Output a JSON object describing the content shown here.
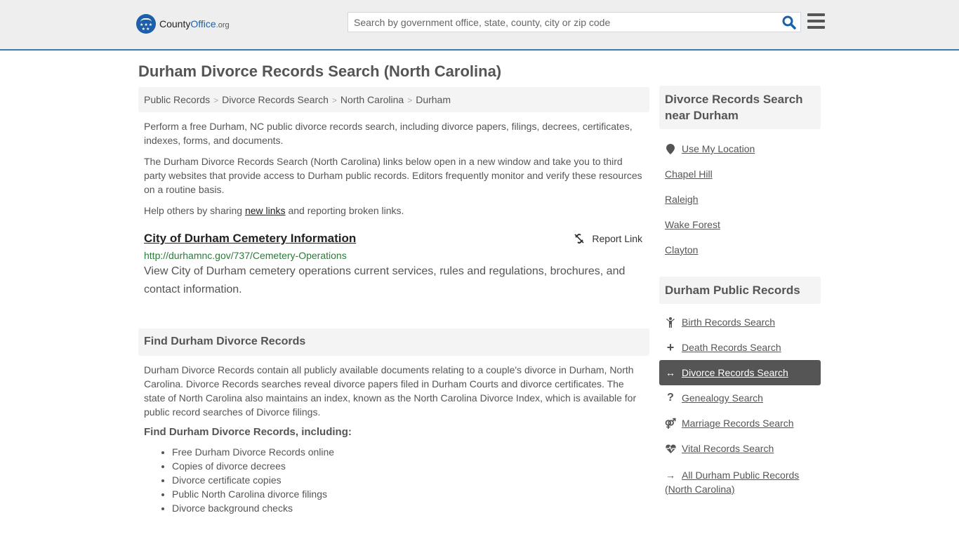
{
  "header": {
    "logo": {
      "county": "County",
      "office": "Office",
      "org": ".org"
    },
    "search_placeholder": "Search by government office, state, county, city or zip code"
  },
  "page_title": "Durham Divorce Records Search (North Carolina)",
  "breadcrumb": [
    "Public Records",
    "Divorce Records Search",
    "North Carolina",
    "Durham"
  ],
  "intro": {
    "p1": "Perform a free Durham, NC public divorce records search, including divorce papers, filings, decrees, certificates, indexes, forms, and documents.",
    "p2": "The Durham Divorce Records Search (North Carolina) links below open in a new window and take you to third party websites that provide access to Durham public records. Editors frequently monitor and verify these resources on a routine basis.",
    "p3_before": "Help others by sharing ",
    "p3_link": "new links",
    "p3_after": " and reporting broken links."
  },
  "result": {
    "title": "City of Durham Cemetery Information",
    "report_label": "Report Link",
    "url": "http://durhamnc.gov/737/Cemetery-Operations",
    "description": "View City of Durham cemetery operations current services, rules and regulations, brochures, and contact information."
  },
  "find_section": {
    "heading": "Find Durham Divorce Records",
    "body": "Durham Divorce Records contain all publicly available documents relating to a couple's divorce in Durham, North Carolina. Divorce Records searches reveal divorce papers filed in Durham Courts and divorce certificates. The state of North Carolina also maintains an index, known as the North Carolina Divorce Index, which is available for public record searches of Divorce filings.",
    "subheading": "Find Durham Divorce Records, including:",
    "items": [
      "Free Durham Divorce Records online",
      "Copies of divorce decrees",
      "Divorce certificate copies",
      "Public North Carolina divorce filings",
      "Divorce background checks"
    ]
  },
  "sidebar": {
    "nearby": {
      "heading": "Divorce Records Search near Durham",
      "use_location": "Use My Location",
      "cities": [
        "Chapel Hill",
        "Raleigh",
        "Wake Forest",
        "Clayton"
      ]
    },
    "public_records": {
      "heading": "Durham Public Records",
      "items": [
        {
          "label": "Birth Records Search",
          "icon": "child-icon"
        },
        {
          "label": "Death Records Search",
          "icon": "plus-icon"
        },
        {
          "label": "Divorce Records Search",
          "icon": "arrows-h-icon",
          "active": true
        },
        {
          "label": "Genealogy Search",
          "icon": "question-icon"
        },
        {
          "label": "Marriage Records Search",
          "icon": "venus-mars-icon"
        },
        {
          "label": "Vital Records Search",
          "icon": "heartbeat-icon"
        },
        {
          "label": "All Durham Public Records (North Carolina)",
          "icon": "arrow-right-icon"
        }
      ]
    }
  },
  "colors": {
    "brand": "#1d5fa8",
    "header_border": "#3a7cb0",
    "url_green": "#2d7a3a",
    "active_bg": "#555555"
  }
}
